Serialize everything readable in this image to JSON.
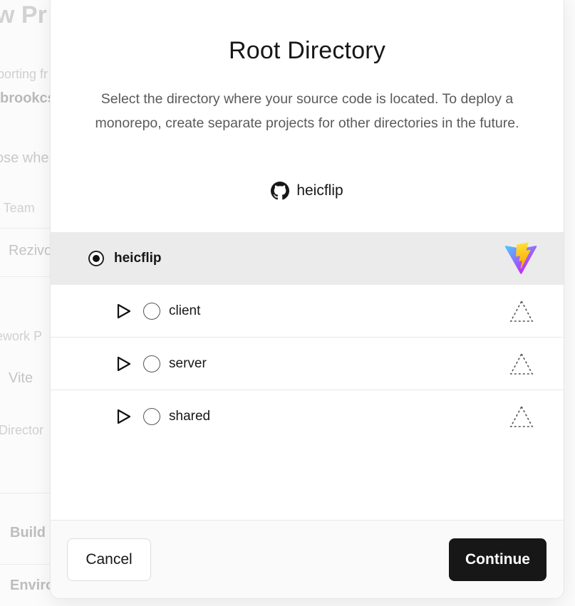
{
  "background": {
    "title": "w Pr",
    "items": [
      "porting fr",
      "brookcs",
      "ose whe",
      "l Team",
      "Rezivo",
      "ework P",
      "Vite",
      "Director",
      "Build a",
      "Enviro"
    ]
  },
  "modal": {
    "title": "Root Directory",
    "description": "Select the directory where your source code is located. To deploy a monorepo, create separate projects for other directories in the future.",
    "repo": {
      "icon": "github-icon",
      "name": "heicflip"
    },
    "directories": [
      {
        "name": "heicflip",
        "selected": true,
        "level": 0,
        "framework_icon": "vite-icon"
      },
      {
        "name": "client",
        "selected": false,
        "level": 1,
        "framework_icon": "unknown-framework-icon"
      },
      {
        "name": "server",
        "selected": false,
        "level": 1,
        "framework_icon": "unknown-framework-icon"
      },
      {
        "name": "shared",
        "selected": false,
        "level": 1,
        "framework_icon": "unknown-framework-icon"
      }
    ],
    "buttons": {
      "cancel": "Cancel",
      "continue": "Continue"
    }
  },
  "colors": {
    "primary_button": "#171717",
    "selected_row": "#ebebeb",
    "vite_purple": "#8d54ff",
    "vite_yellow": "#ffd028"
  }
}
